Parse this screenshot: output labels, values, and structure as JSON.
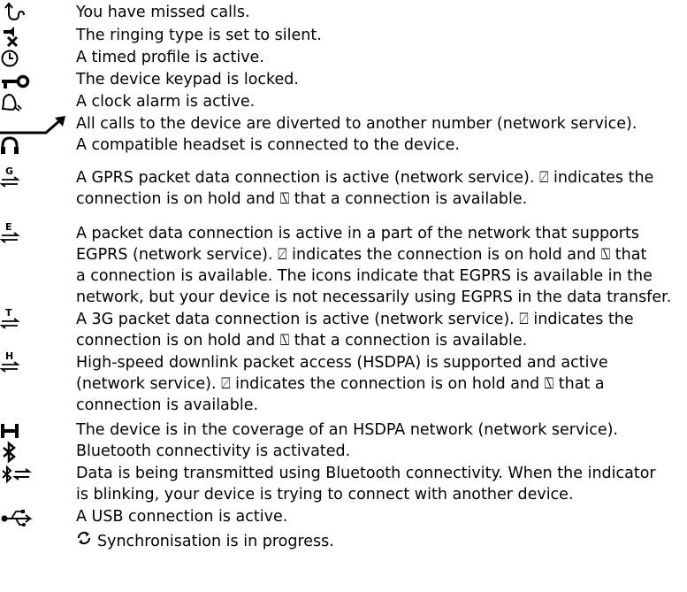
{
  "indicators": [
    {
      "icon": "missed-calls-icon",
      "text": "You have missed calls."
    },
    {
      "icon": "silent-ringing-icon",
      "text": "The ringing type is set to silent."
    },
    {
      "icon": "timed-profile-icon",
      "text": "A timed profile is active."
    },
    {
      "icon": "keypad-locked-icon",
      "text": "The device keypad is locked."
    },
    {
      "icon": "clock-alarm-icon",
      "text": "A clock alarm is active."
    },
    {
      "icon": "call-divert-icon",
      "text": "All calls to the device are diverted to another number (network service)."
    },
    {
      "icon": "headset-icon",
      "text": "A compatible headset is connected to the device."
    },
    {
      "icon": "gprs-icon",
      "text": "A GPRS packet data connection is active (network service). ⍁ indicates the\nconnection is on hold and ⍂ that a connection is available."
    },
    {
      "icon": "egprs-icon",
      "text": "A packet data connection is active in a part of the network that supports\nEGPRS (network service). ⍁ indicates the connection is on hold and ⍂ that\na connection is available. The icons indicate that EGPRS is available in the\nnetwork, but your device is not necessarily using EGPRS in the data transfer."
    },
    {
      "icon": "3g-packet-icon",
      "text": "A 3G packet data connection is active (network service). ⍁ indicates the\nconnection is on hold and ⍂ that a connection is available."
    },
    {
      "icon": "hsdpa-packet-icon",
      "text": "High-speed downlink packet access (HSDPA) is supported and active\n(network service). ⍁ indicates the connection is on hold and ⍂ that a\nconnection is available."
    },
    {
      "icon": "hsdpa-coverage-icon",
      "text": "The device is in the coverage of an HSDPA network (network service)."
    },
    {
      "icon": "bluetooth-icon",
      "text": "Bluetooth connectivity is activated."
    },
    {
      "icon": "bluetooth-transfer-icon",
      "text": "Data is being transmitted using Bluetooth connectivity. When the indicator\nis blinking, your device is trying to connect with another device."
    },
    {
      "icon": "usb-icon",
      "text": "A USB connection is active."
    }
  ],
  "sync": {
    "icon": "sync-icon",
    "text": "Synchronisation is in progress."
  }
}
